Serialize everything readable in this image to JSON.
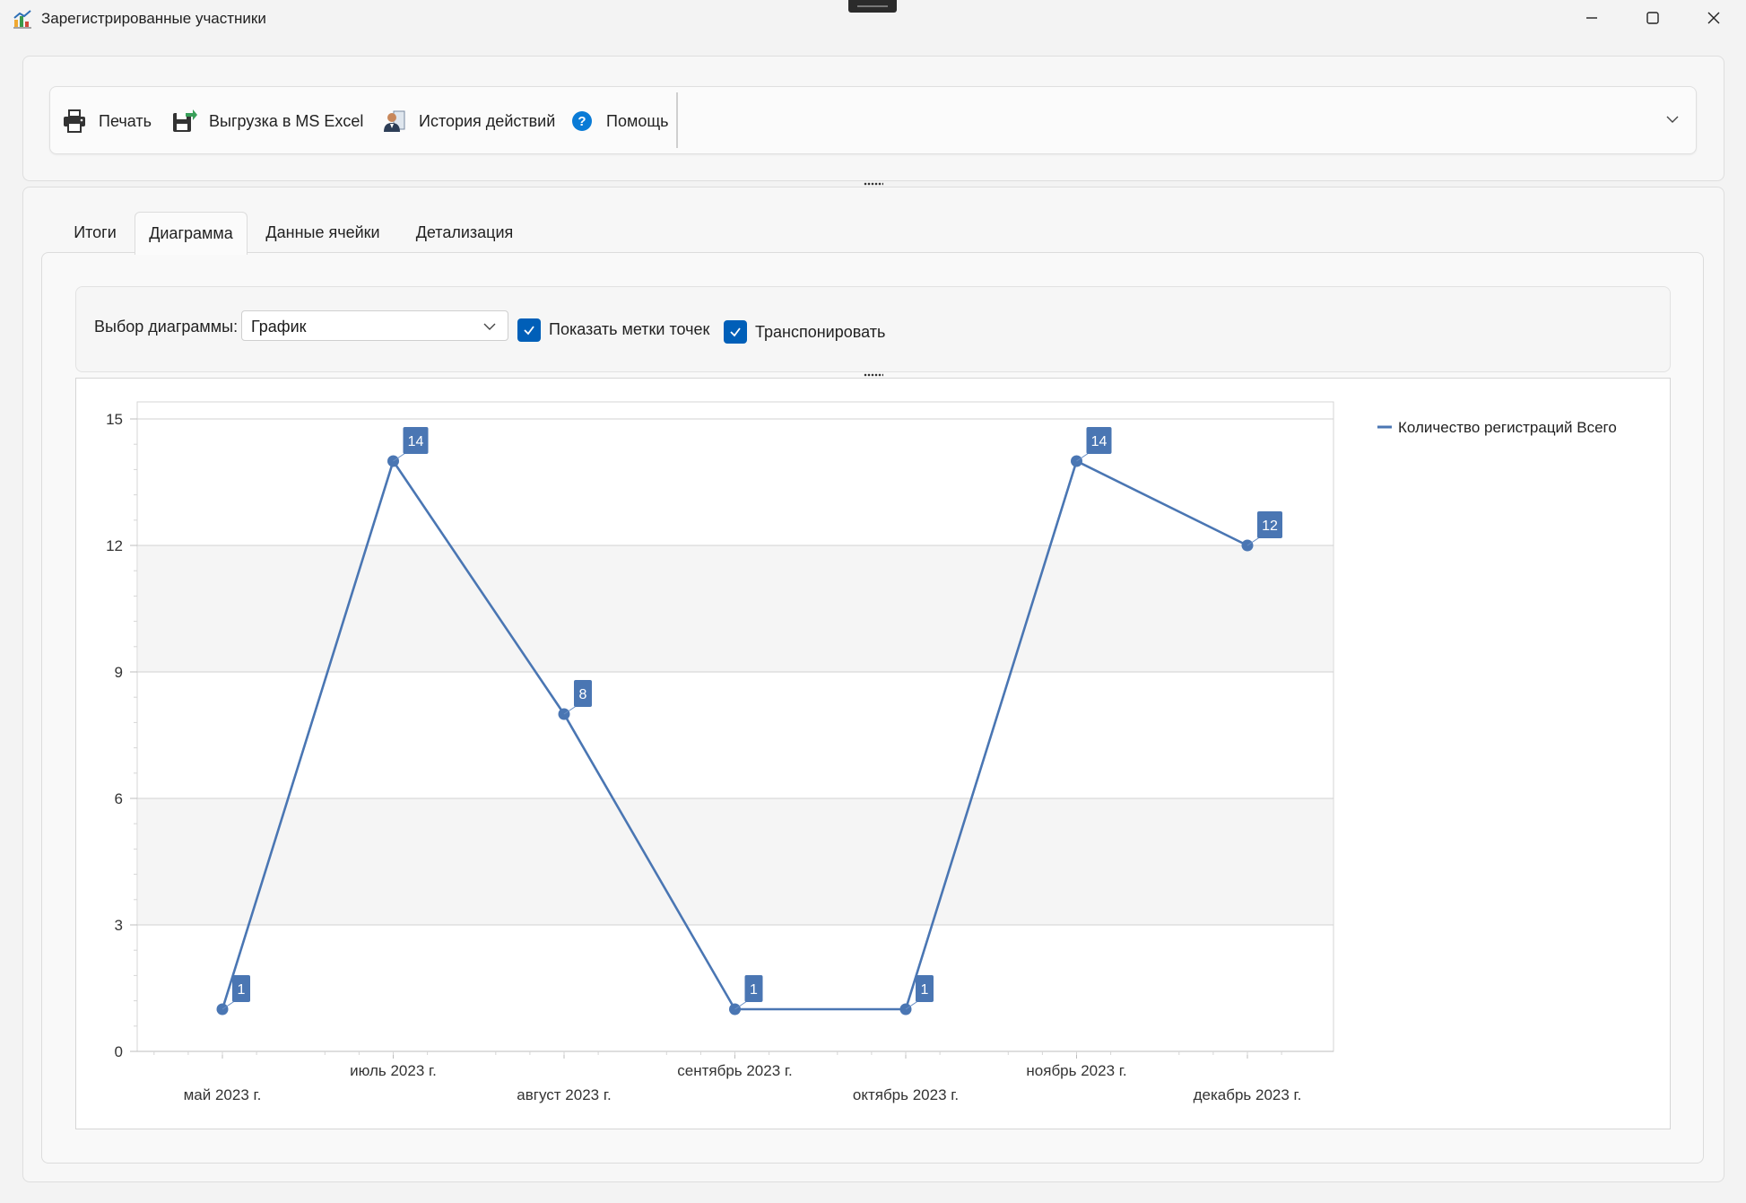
{
  "window": {
    "title": "Зарегистрированные участники"
  },
  "toolbar": {
    "print": "Печать",
    "excel": "Выгрузка в MS Excel",
    "history": "История действий",
    "help": "Помощь"
  },
  "tabs": [
    {
      "label": "Итоги"
    },
    {
      "label": "Диаграмма"
    },
    {
      "label": "Данные ячейки"
    },
    {
      "label": "Детализация"
    }
  ],
  "options": {
    "chart_select_label": "Выбор диаграммы:",
    "chart_select_value": "График",
    "show_labels_label": "Показать метки точек",
    "show_labels_checked": true,
    "transpose_label": "Транспонировать",
    "transpose_checked": true
  },
  "chart_data": {
    "type": "line",
    "categories": [
      "май 2023 г.",
      "июль 2023 г.",
      "август 2023 г.",
      "сентябрь 2023 г.",
      "октябрь 2023 г.",
      "ноябрь 2023 г.",
      "декабрь 2023 г."
    ],
    "series": [
      {
        "name": "Количество регистраций Всего",
        "values": [
          1,
          14,
          8,
          1,
          1,
          14,
          12
        ],
        "color": "#4a76b3"
      }
    ],
    "ylim": [
      0,
      15
    ],
    "yticks": [
      0,
      3,
      6,
      9,
      12,
      15
    ],
    "grid": true,
    "point_labels": true,
    "legend": "top-right"
  }
}
